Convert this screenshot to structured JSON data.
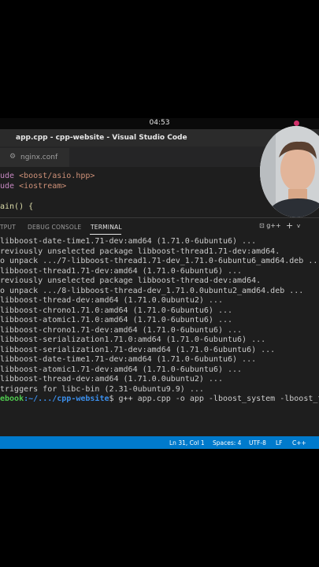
{
  "system": {
    "clock": "04:53"
  },
  "window": {
    "title": "app.cpp - cpp-website - Visual Studio Code"
  },
  "tabs": [
    {
      "label": "nginx.conf"
    }
  ],
  "editor": {
    "line1_kw": "ude",
    "line1_str": " <boost/asio.hpp>",
    "line2_kw": "ude",
    "line2_str": " <iostream>",
    "line3": "ain() {"
  },
  "panel": {
    "tabs": [
      {
        "label": "TPUT"
      },
      {
        "label": "DEBUG CONSOLE"
      },
      {
        "label": "TERMINAL"
      }
    ],
    "terminal_selector": "g++",
    "add": "+",
    "chevron": "v"
  },
  "terminal": {
    "lines": [
      "libboost-date-time1.71-dev:amd64 (1.71.0-6ubuntu6) ...",
      "reviously unselected package libboost-thread1.71-dev:amd64.",
      "o unpack .../7-libboost-thread1.71-dev_1.71.0-6ubuntu6_amd64.deb ...",
      "libboost-thread1.71-dev:amd64 (1.71.0-6ubuntu6) ...",
      "reviously unselected package libboost-thread-dev:amd64.",
      "o unpack .../8-libboost-thread-dev_1.71.0.0ubuntu2_amd64.deb ...",
      "libboost-thread-dev:amd64 (1.71.0.0ubuntu2) ...",
      "libboost-chrono1.71.0:amd64 (1.71.0-6ubuntu6) ...",
      "libboost-atomic1.71.0:amd64 (1.71.0-6ubuntu6) ...",
      "libboost-chrono1.71-dev:amd64 (1.71.0-6ubuntu6) ...",
      "libboost-serialization1.71.0:amd64 (1.71.0-6ubuntu6) ...",
      "libboost-serialization1.71-dev:amd64 (1.71.0-6ubuntu6) ...",
      "libboost-date-time1.71-dev:amd64 (1.71.0-6ubuntu6) ...",
      "libboost-atomic1.71-dev:amd64 (1.71.0-6ubuntu6) ...",
      "libboost-thread-dev:amd64 (1.71.0.0ubuntu2) ...",
      "triggers for libc-bin (2.31-0ubuntu9.9) ..."
    ],
    "prompt_user": "ebook",
    "prompt_path": ":~/.../cpp-website",
    "prompt_cmd": "$ g++ app.cpp -o app -lboost_system -lboost_thr"
  },
  "status": {
    "position": "Ln 31, Col 1",
    "spaces": "Spaces: 4",
    "encoding": "UTF-8",
    "eol": "LF",
    "language": "C++"
  },
  "colors": {
    "statusbar": "#007acc",
    "background": "#1e1e1e",
    "prompt_user": "#4ec84e",
    "prompt_path": "#3b8eea"
  }
}
